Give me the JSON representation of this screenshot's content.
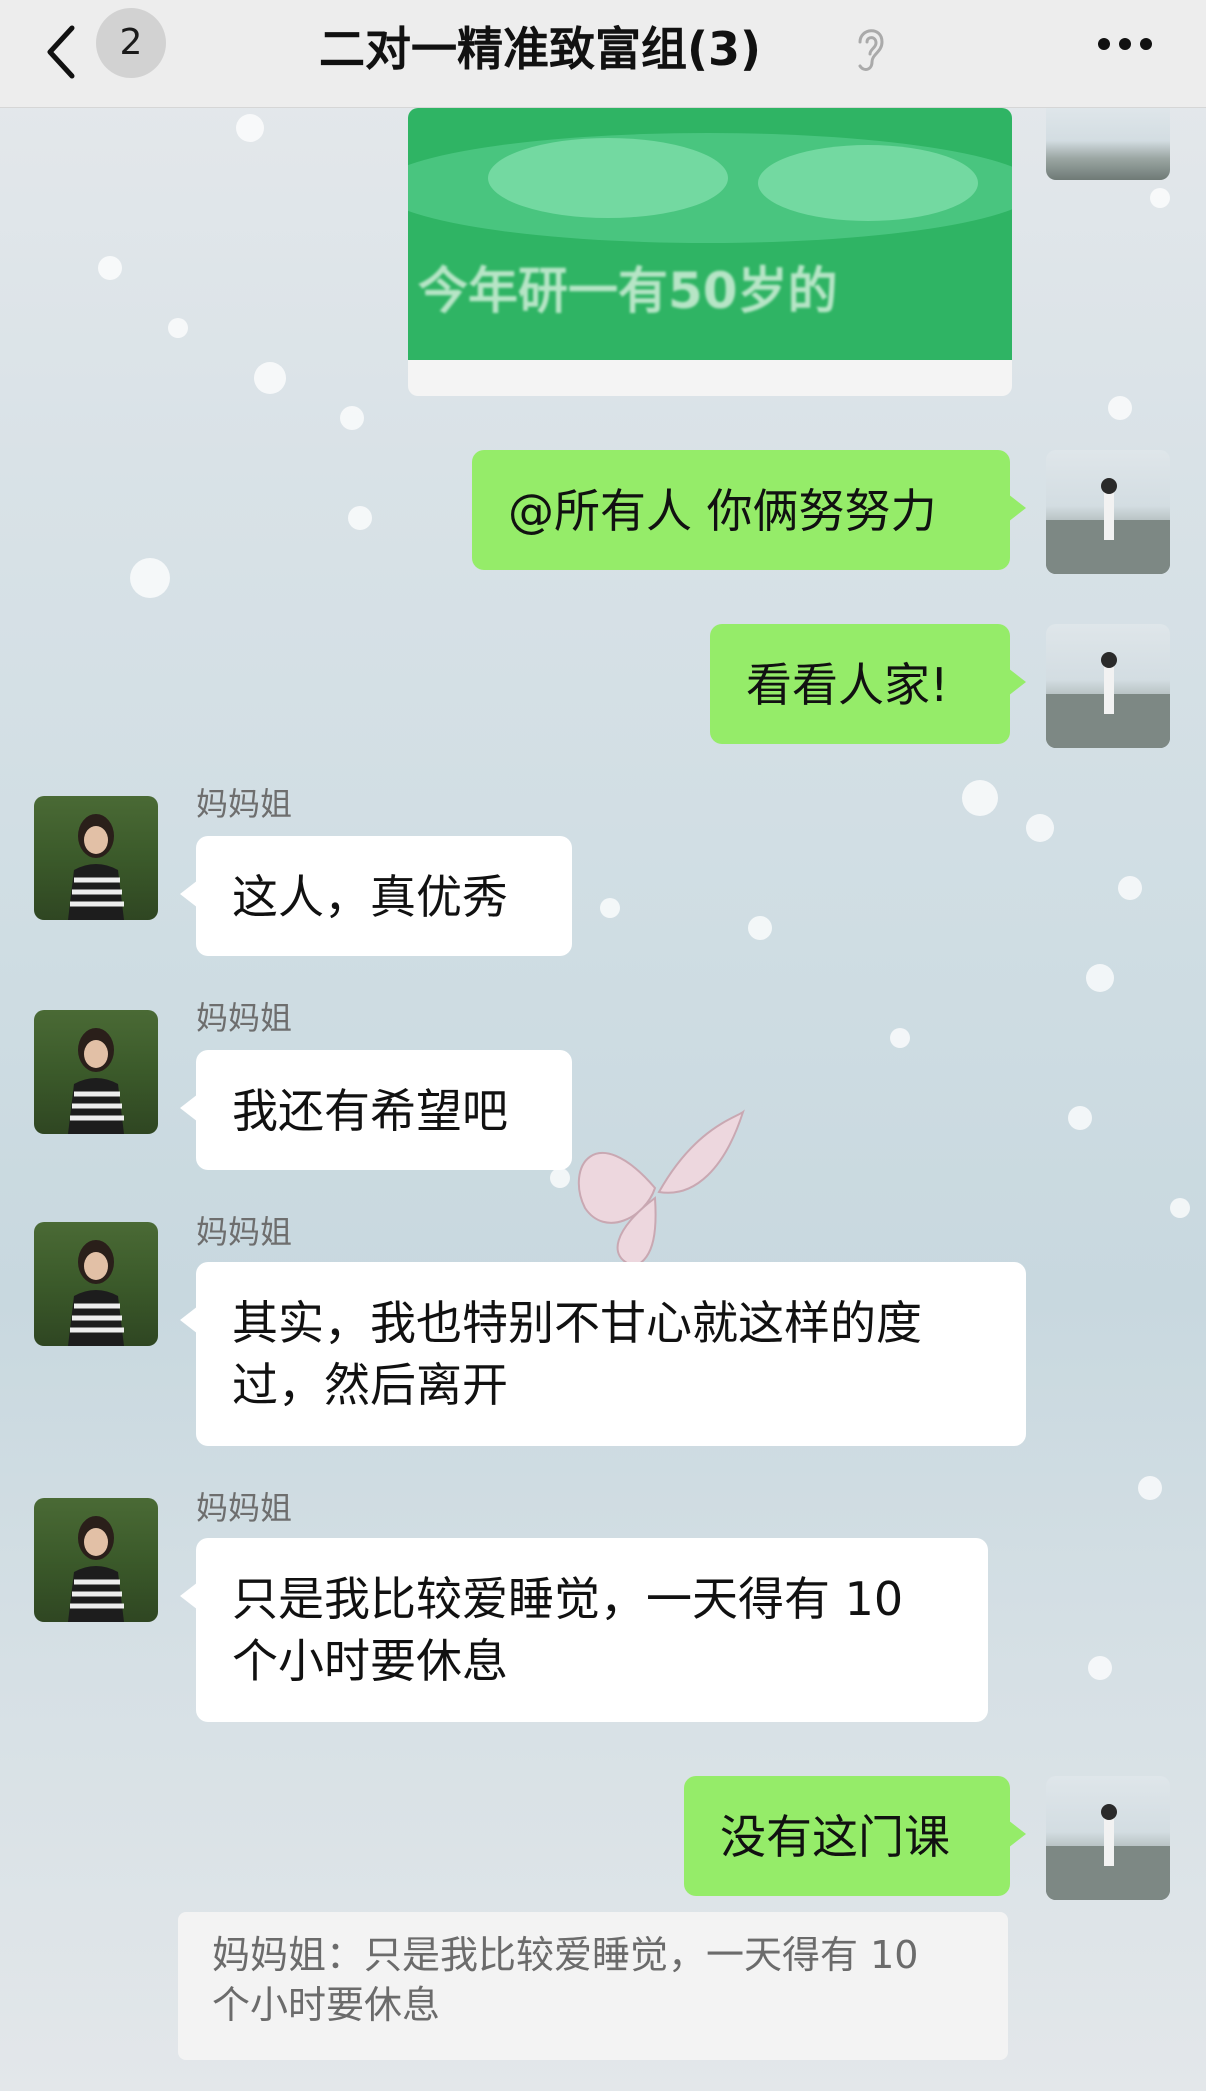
{
  "header": {
    "back_icon": "chevron-left-icon",
    "unread_count": "2",
    "title": "二对一精准致富组(3)",
    "ear_icon": "ear-icon",
    "more_icon": "more-dots-icon"
  },
  "messages": {
    "image_caption": "今年研一有50岁的",
    "m1": "@所有人 你俩努努力",
    "m2": "看看人家!",
    "m3_sender": "妈妈姐",
    "m3": "这人，真优秀",
    "m4_sender": "妈妈姐",
    "m4": "我还有希望吧",
    "m5_sender": "妈妈姐",
    "m5_line1": "其实，我也特别不甘心就这样的度",
    "m5_line2": "过，然后离开",
    "m6_sender": "妈妈姐",
    "m6_line1": "只是我比较爱睡觉，一天得有 10",
    "m6_line2": "个小时要休息",
    "m7": "没有这门课"
  },
  "quote": {
    "line1": "妈妈姐：只是我比较爱睡觉，一天得有 10",
    "line2": "个小时要休息"
  },
  "colors": {
    "self_bubble": "#95ec69",
    "other_bubble": "#ffffff",
    "header_bg": "#ededed"
  }
}
